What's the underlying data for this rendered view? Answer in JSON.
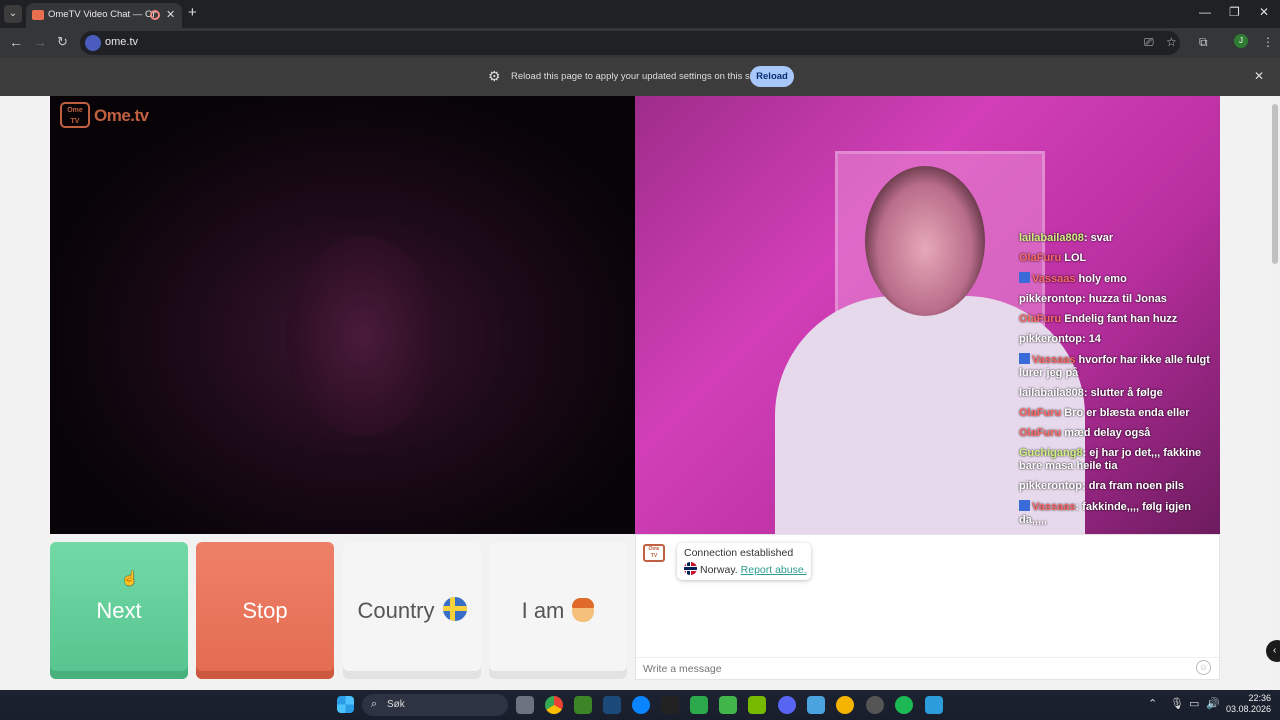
{
  "browser": {
    "tab_title": "OmeTV Video Chat — Ome",
    "url": "ome.tv",
    "profile_initial": "J"
  },
  "infobar": {
    "message": "Reload this page to apply your updated settings on this site",
    "reload_label": "Reload"
  },
  "logo": {
    "box_text": "Ome TV",
    "name": "Ome.tv"
  },
  "stream_chat": [
    {
      "user": "lailabaila808",
      "sep": ":",
      "text": "svar",
      "color": "green"
    },
    {
      "user": "OlaFuru",
      "sep": "",
      "text": "LOL",
      "color": "red"
    },
    {
      "user": "Vassaas",
      "sep": "",
      "text": "holy emo",
      "color": "red",
      "badge": true
    },
    {
      "user": "pikkerontop",
      "sep": ":",
      "text": "huzza til Jonas",
      "color": "white"
    },
    {
      "user": "OlaFuru",
      "sep": "",
      "text": "Endelig fant han huzz",
      "color": "red"
    },
    {
      "user": "pikkerontop",
      "sep": ":",
      "text": "14",
      "color": "white"
    },
    {
      "user": "Vassaas",
      "sep": "",
      "text": "hvorfor har ikke alle fulgt lurer jeg på",
      "color": "red",
      "badge": true
    },
    {
      "user": "lailabaila808",
      "sep": ":",
      "text": "slutter å følge",
      "color": "white"
    },
    {
      "user": "OlaFuru",
      "sep": "",
      "text": "Bro er blæsta enda eller",
      "color": "red"
    },
    {
      "user": "OlaFuru",
      "sep": "",
      "text": "mæd delay også",
      "color": "red"
    },
    {
      "user": "Guchigang8",
      "sep": ":",
      "text": "ej har jo det,,, fakkine bare masa heile tia",
      "color": "green"
    },
    {
      "user": "pikkerontop",
      "sep": ":",
      "text": "dra fram noen pils",
      "color": "white"
    },
    {
      "user": "Vassaas",
      "sep": ":",
      "text": "fakkinde,,,, følg igjen da,,,,,",
      "color": "red",
      "badge": true
    }
  ],
  "buttons": {
    "next": "Next",
    "stop": "Stop",
    "country": "Country",
    "iam": "I am"
  },
  "chat": {
    "status": "Connection established",
    "country": "Norway.",
    "report": "Report abuse.",
    "placeholder": "Write a message"
  },
  "taskbar": {
    "search_label": "Søk",
    "time": "22:36",
    "date": "03.08.2026"
  }
}
